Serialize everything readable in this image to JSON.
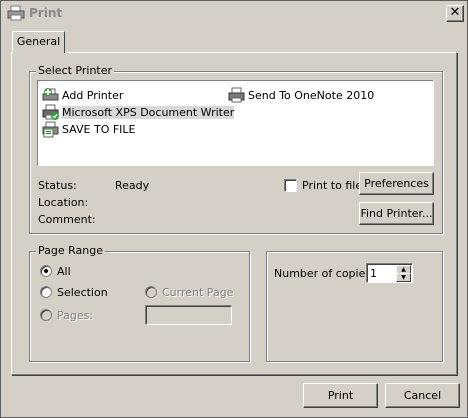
{
  "window": {
    "title": "Print",
    "close_glyph": "✕"
  },
  "tabs": [
    {
      "label": "General"
    }
  ],
  "select_printer": {
    "group_label": "Select Printer",
    "printers": [
      {
        "name": "Add Printer",
        "icon": "add-printer-icon"
      },
      {
        "name": "Microsoft XPS Document Writer",
        "icon": "xps-printer-icon",
        "selected": true
      },
      {
        "name": "SAVE TO FILE",
        "icon": "save-file-printer-icon"
      },
      {
        "name": "Send To OneNote 2010",
        "icon": "printer-icon"
      }
    ],
    "status_label": "Status:",
    "status_value": "Ready",
    "location_label": "Location:",
    "comment_label": "Comment:",
    "print_to_file_label": "Print to file",
    "print_to_file_checked": false,
    "preferences_label": "Preferences",
    "find_printer_label": "Find Printer..."
  },
  "page_range": {
    "group_label": "Page Range",
    "options": [
      {
        "label": "All",
        "checked": true,
        "enabled": true
      },
      {
        "label": "Selection",
        "checked": false,
        "enabled": true
      },
      {
        "label": "Current Page",
        "checked": false,
        "enabled": false
      },
      {
        "label": "Pages:",
        "checked": false,
        "enabled": false
      }
    ],
    "pages_value": ""
  },
  "copies": {
    "label": "Number of copies:",
    "value": "1"
  },
  "footer": {
    "print_label": "Print",
    "cancel_label": "Cancel"
  }
}
